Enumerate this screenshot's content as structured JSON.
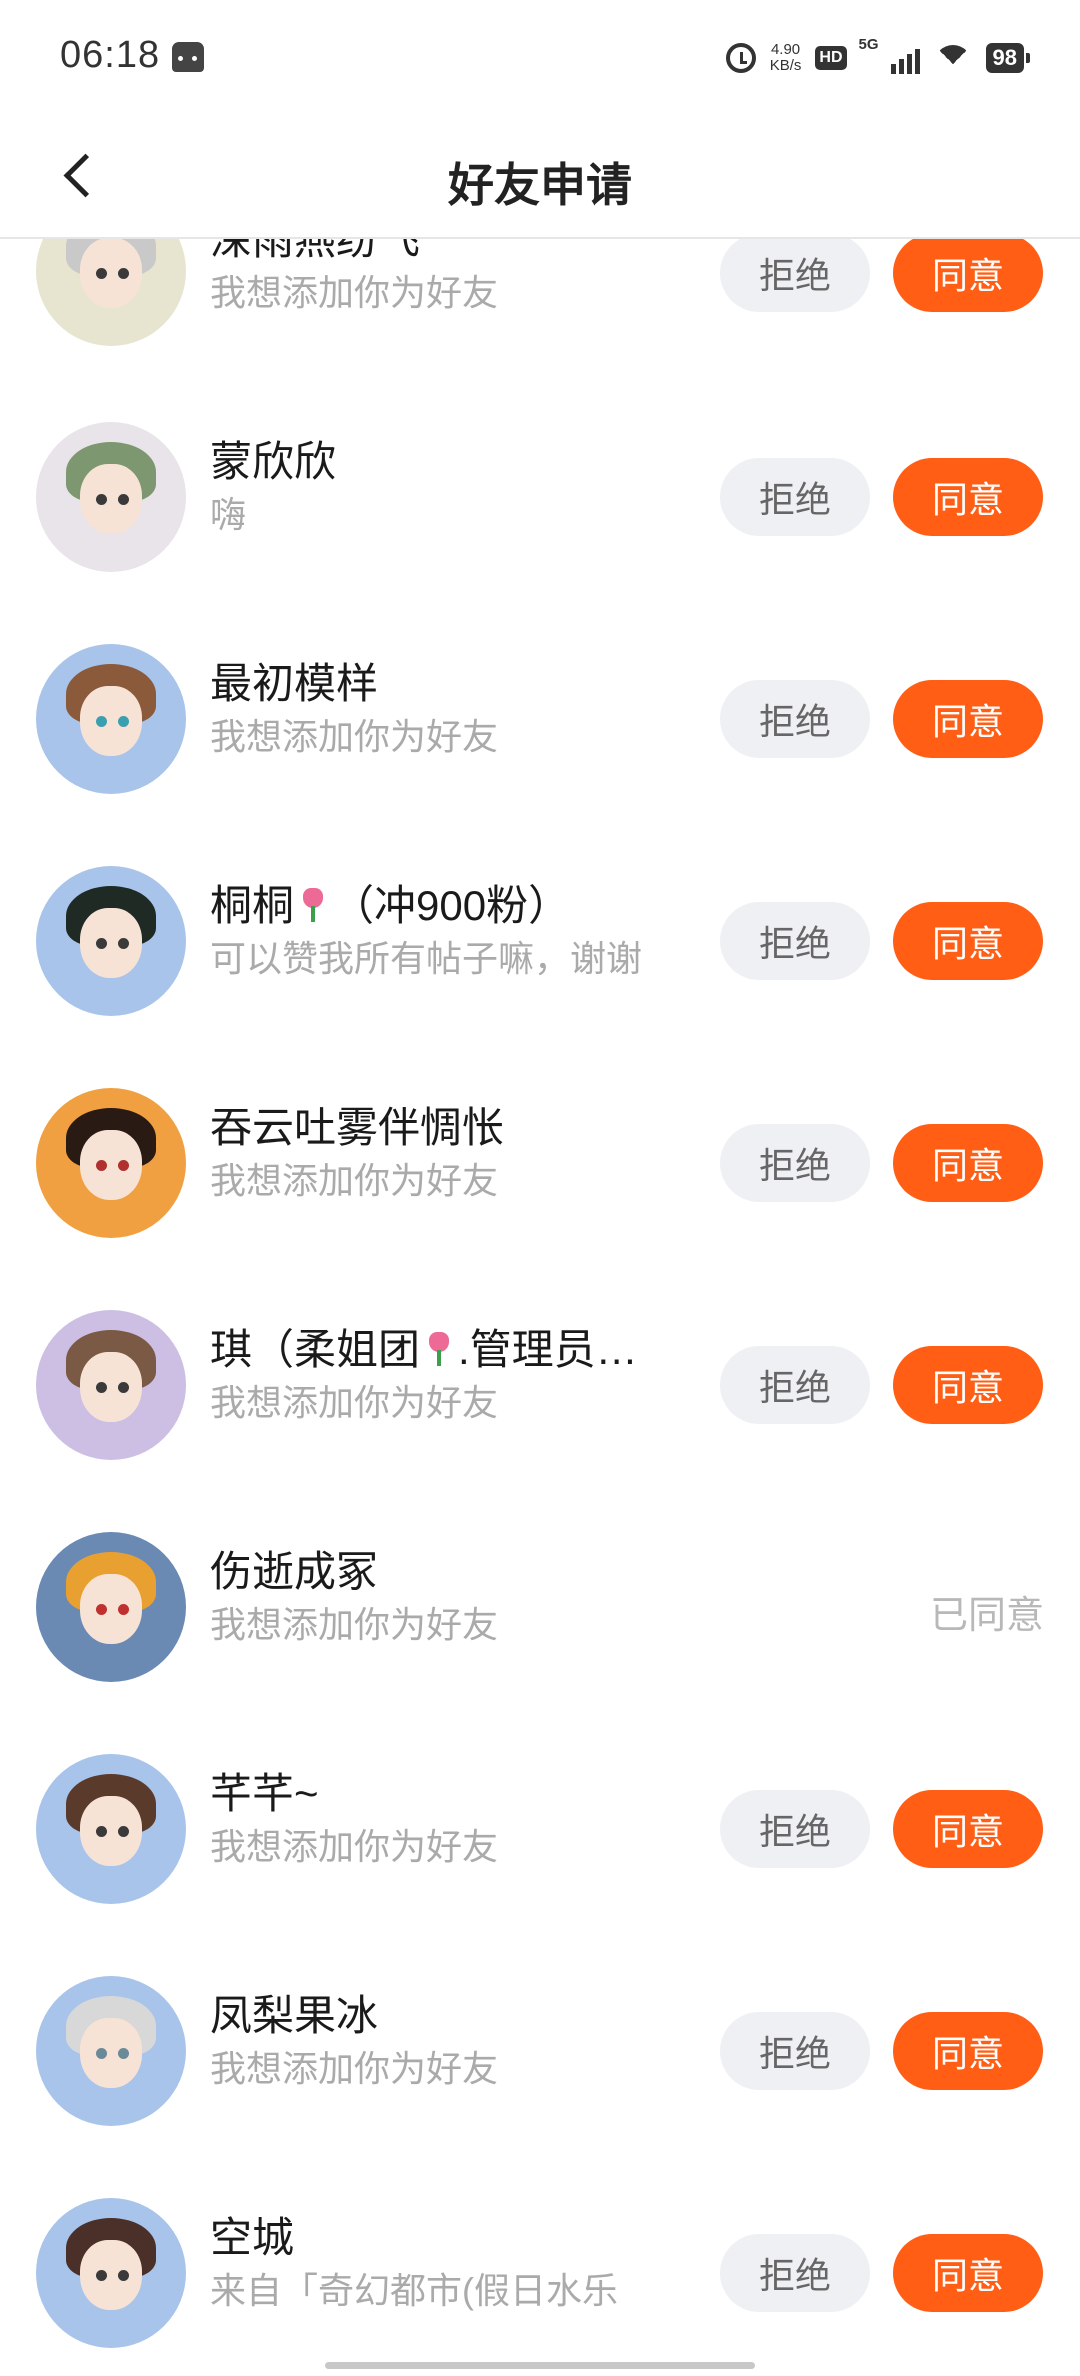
{
  "status_bar": {
    "time": "06:18",
    "net_speed_value": "4.90",
    "net_speed_unit": "KB/s",
    "hd": "HD",
    "network": "5G",
    "battery": "98",
    "icons": [
      "app-icon",
      "alarm-icon",
      "hd-icon",
      "signal-icon",
      "wifi-icon",
      "battery-icon"
    ]
  },
  "nav": {
    "title": "好友申请",
    "back_icon": "chevron-left-icon"
  },
  "colors": {
    "accept": "#ff5e14",
    "reject_bg": "#eef0f4",
    "secondary_text": "#aaaaaa"
  },
  "requests": [
    {
      "name": "深雨燕纷飞",
      "message": "我想添加你为好友",
      "reject": "拒绝",
      "accept": "同意"
    },
    {
      "name": "蒙欣欣",
      "message": "嗨",
      "reject": "拒绝",
      "accept": "同意"
    },
    {
      "name": "最初模样",
      "message": "我想添加你为好友",
      "reject": "拒绝",
      "accept": "同意"
    },
    {
      "name": "桐桐 （冲900粉）",
      "message": "可以赞我所有帖子嘛，谢谢",
      "reject": "拒绝",
      "accept": "同意"
    },
    {
      "name": "吞云吐雾伴惆怅",
      "message": "我想添加你为好友",
      "reject": "拒绝",
      "accept": "同意"
    },
    {
      "name": "琪（柔姐团 .管理员…",
      "message": "我想添加你为好友",
      "reject": "拒绝",
      "accept": "同意"
    },
    {
      "name": "伤逝成冢",
      "message": "我想添加你为好友",
      "status": "已同意"
    },
    {
      "name": "芊芊~",
      "message": "我想添加你为好友",
      "reject": "拒绝",
      "accept": "同意"
    },
    {
      "name": "凤梨果冰",
      "message": "我想添加你为好友",
      "reject": "拒绝",
      "accept": "同意"
    },
    {
      "name": "空城",
      "message": "来自「奇幻都市(假日水乐",
      "reject": "拒绝",
      "accept": "同意"
    }
  ]
}
